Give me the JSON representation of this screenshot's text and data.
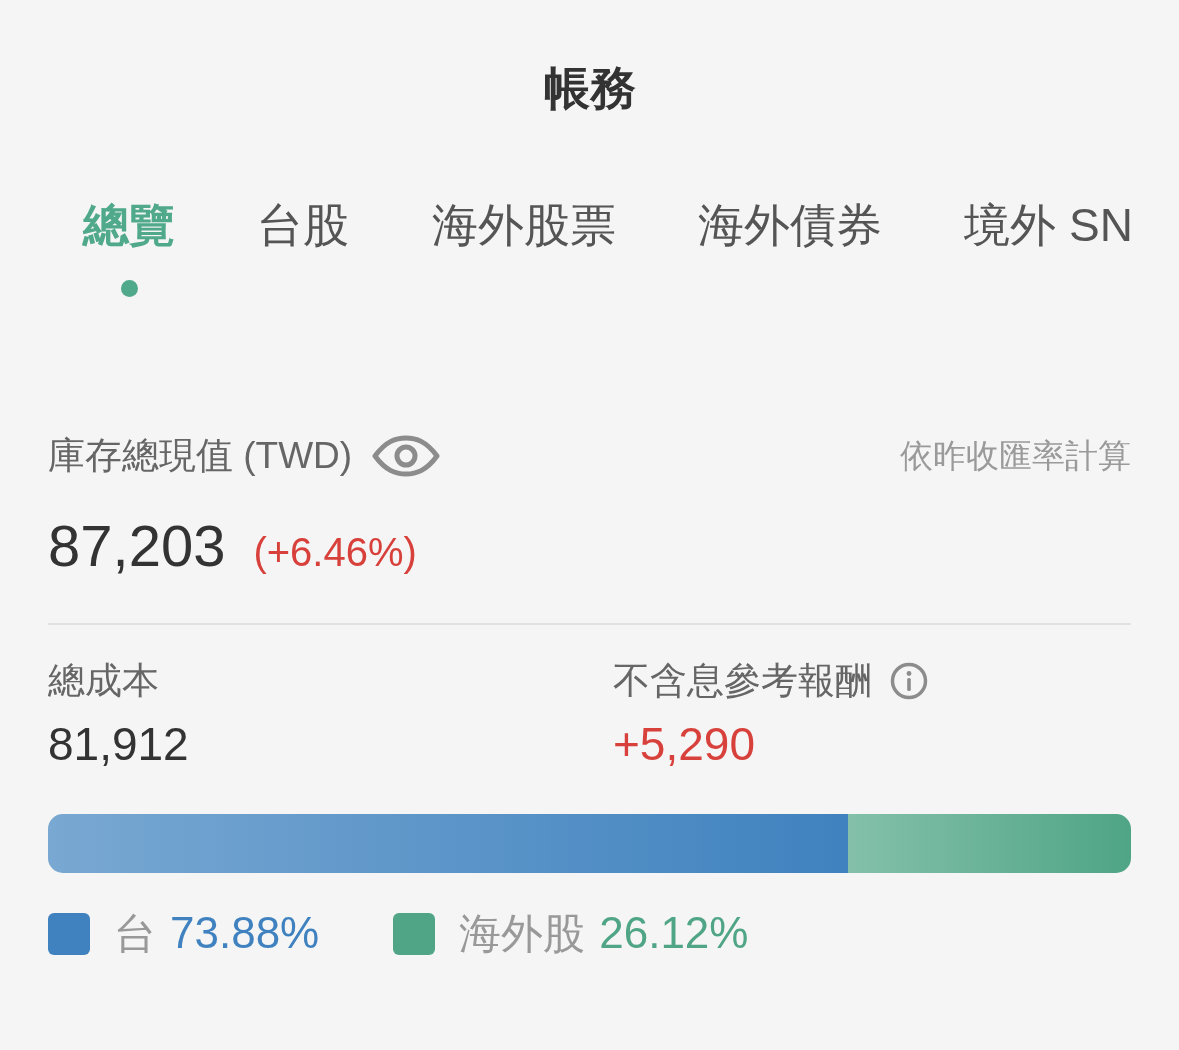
{
  "header": {
    "title": "帳務"
  },
  "tabs": [
    {
      "label": "總覽",
      "selected": true
    },
    {
      "label": "台股",
      "selected": false
    },
    {
      "label": "海外股票",
      "selected": false
    },
    {
      "label": "海外債券",
      "selected": false
    },
    {
      "label": "境外 SN",
      "selected": false
    }
  ],
  "portfolio": {
    "label": "庫存總現值 (TWD)",
    "note": "依昨收匯率計算",
    "value": "87,203",
    "change": "(+6.46%)"
  },
  "cost": {
    "label": "總成本",
    "value": "81,912"
  },
  "return": {
    "label": "不含息參考報酬",
    "value": "+5,290"
  },
  "allocation": [
    {
      "label": "台",
      "percent": "73.88%",
      "level": 0.7388,
      "color": "#3f82bf"
    },
    {
      "label": "海外股",
      "percent": "26.12%",
      "level": 0.2612,
      "color": "#4fa586"
    }
  ]
}
